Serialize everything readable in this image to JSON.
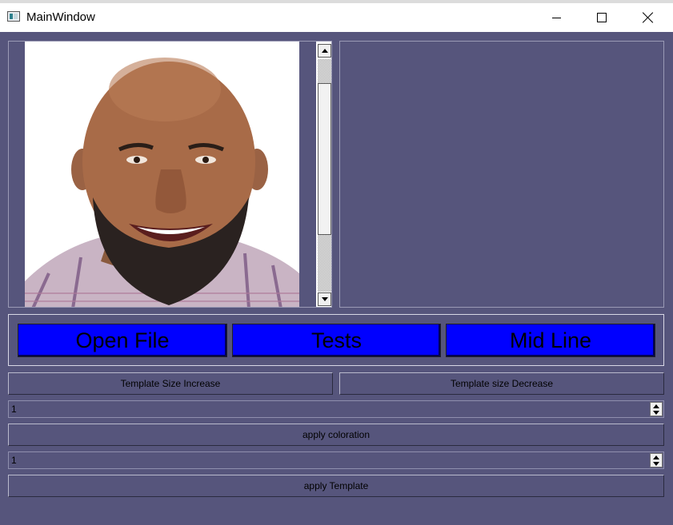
{
  "window": {
    "title": "MainWindow"
  },
  "icons": {
    "app": "app-window-icon",
    "minimize": "minimize-icon",
    "maximize": "maximize-icon",
    "close": "close-icon",
    "scroll_up": "arrow-up-icon",
    "scroll_down": "arrow-down-icon"
  },
  "image_panel": {
    "photo": "portrait of smiling bald man with beard"
  },
  "main_buttons": {
    "open_file": "Open File",
    "tests": "Tests",
    "mid_line": "Mid Line"
  },
  "template_buttons": {
    "increase": "Template Size Increase",
    "decrease": "Template size Decrease"
  },
  "coloration": {
    "spin_value": "1",
    "apply_label": "apply coloration"
  },
  "template": {
    "spin_value": "1",
    "apply_label": "apply Template"
  },
  "colors": {
    "background": "#56557c",
    "button_blue": "#0000ff",
    "titlebar": "#ffffff"
  }
}
